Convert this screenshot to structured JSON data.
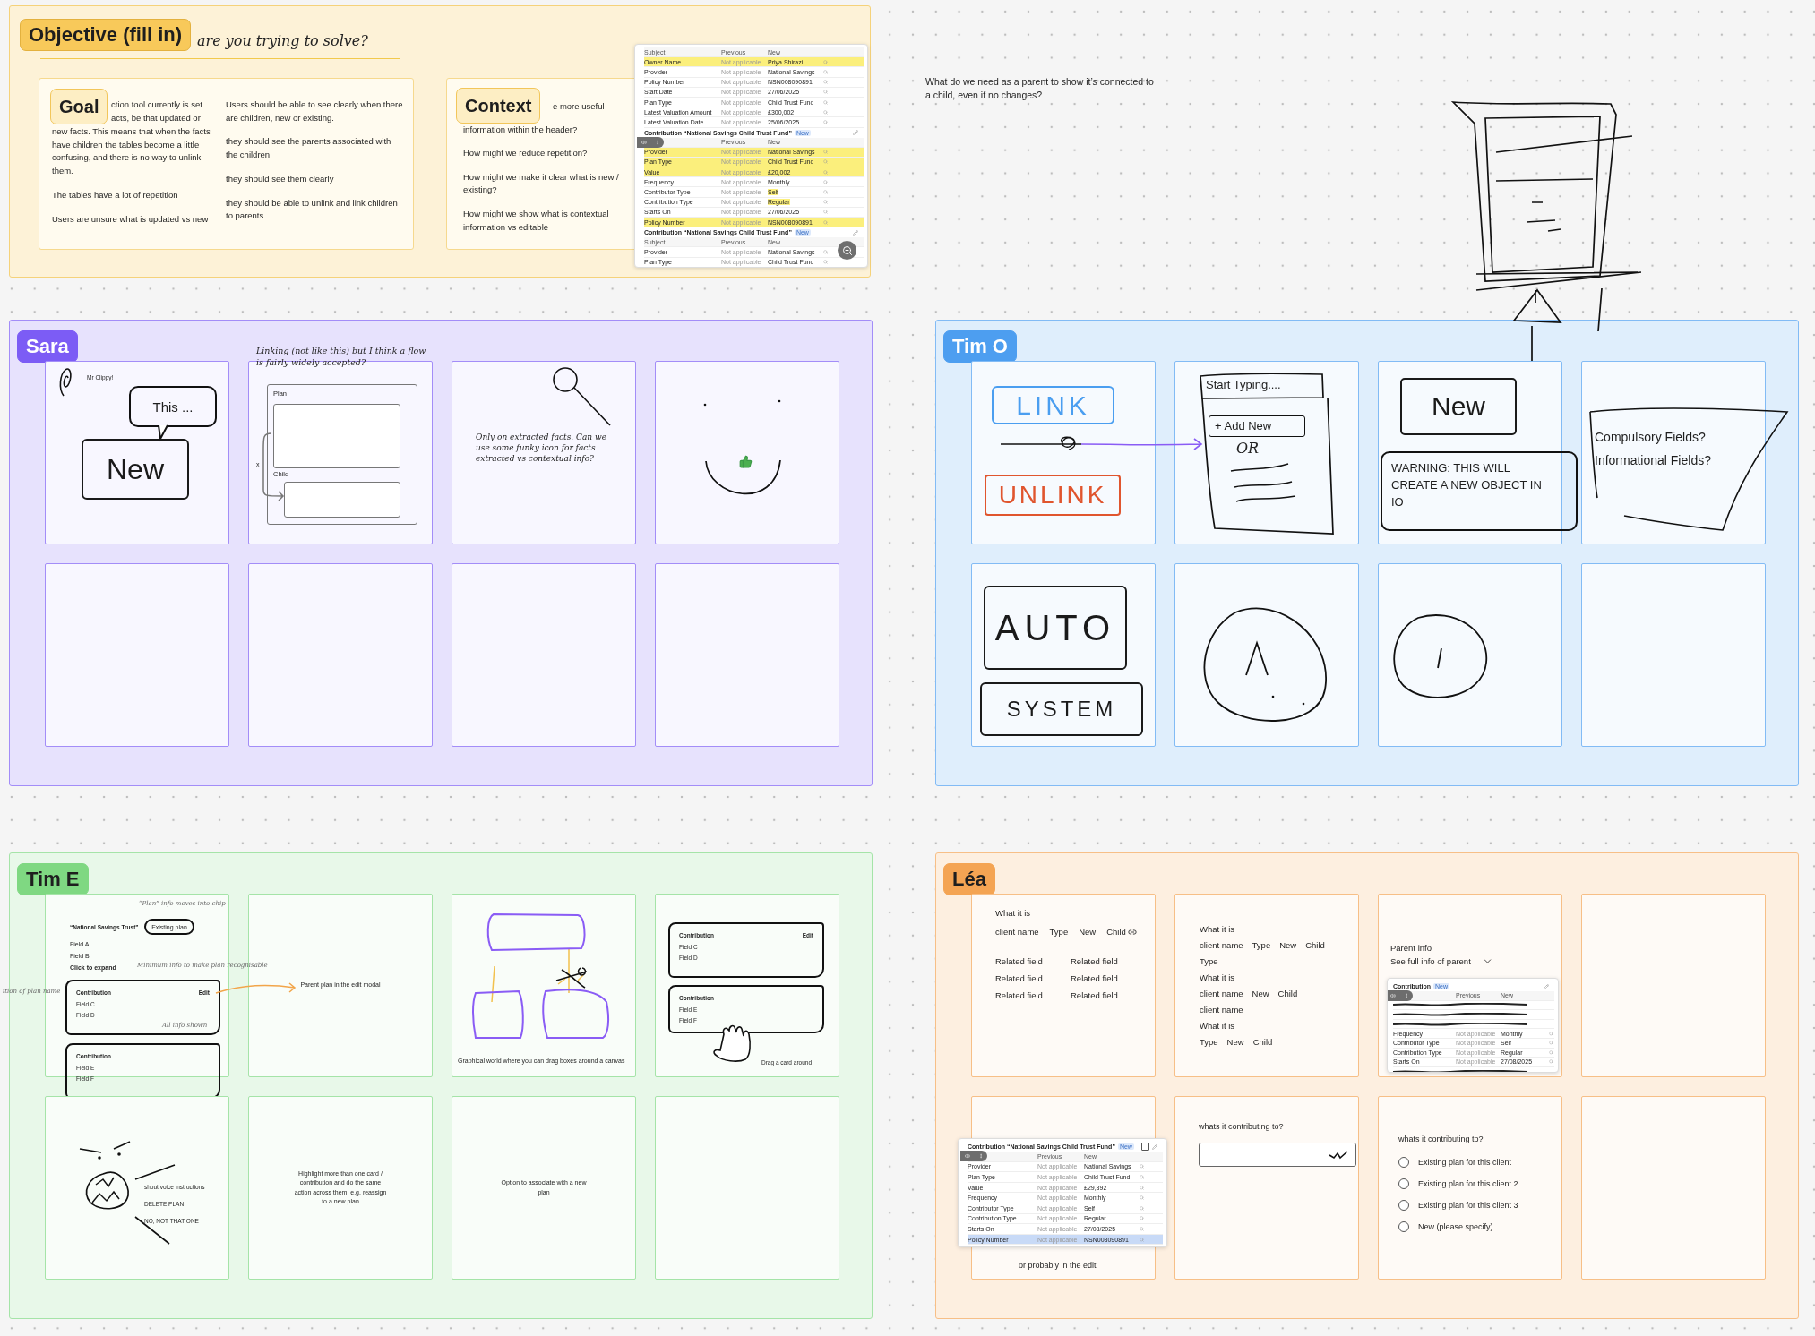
{
  "objective": {
    "title": "Objective (fill in)",
    "note": "are you trying to solve?",
    "goal": {
      "label": "Goal",
      "fragments": [
        "ction tool currently is set",
        "acts, be that updated or"
      ],
      "left": [
        "new facts. This means that when the facts have children the tables become a little confusing, and there is no way to unlink them.",
        "The tables have a lot of repetition",
        "Users are unsure what is updated vs new"
      ],
      "right": [
        "Users should be able to see clearly when there are children, new or existing.",
        "they should see the parents associated with the children",
        "they should see them clearly",
        "they should be able to unlink and link children to parents."
      ]
    },
    "context": {
      "label": "Context",
      "fragments": [
        "e more useful",
        "information within the header?"
      ],
      "questions": [
        "How might we reduce repetition?",
        "How might we make it clear what is new / existing?",
        "How might we show what is contextual information vs editable"
      ]
    },
    "screenshot": {
      "rows": [
        {
          "kind": "head",
          "cells": [
            "Subject",
            "Previous",
            "New"
          ],
          "covered": false
        },
        {
          "kind": "marked",
          "cells": [
            "Owner Name",
            "Not applicable",
            "Priya Shirazi"
          ],
          "color": "#fbef7c"
        },
        {
          "kind": "data",
          "cells": [
            "Provider",
            "Not applicable",
            "National Savings"
          ]
        },
        {
          "kind": "data",
          "cells": [
            "Policy Number",
            "Not applicable",
            "NSN008090891"
          ]
        },
        {
          "kind": "data",
          "cells": [
            "Start Date",
            "Not applicable",
            "27/06/2025"
          ]
        },
        {
          "kind": "data",
          "cells": [
            "Plan Type",
            "Not applicable",
            "Child Trust Fund"
          ]
        },
        {
          "kind": "data",
          "cells": [
            "Latest Valuation Amount",
            "Not applicable",
            "£300,002"
          ]
        },
        {
          "kind": "data",
          "cells": [
            "Latest Valuation Date",
            "Not applicable",
            "25/06/2025"
          ]
        },
        {
          "kind": "section",
          "title": "Contribution “National Savings Child Trust Fund”",
          "badge": "New"
        },
        {
          "kind": "head",
          "cells": [
            "Previous",
            "New"
          ],
          "covered": true
        },
        {
          "kind": "marked",
          "cells": [
            "Provider",
            "Not applicable",
            "National Savings"
          ],
          "color": "#fbef7c"
        },
        {
          "kind": "marked",
          "cells": [
            "Plan Type",
            "Not applicable",
            "Child Trust Fund"
          ],
          "color": "#fbef7c"
        },
        {
          "kind": "marked",
          "cells": [
            "Value",
            "Not applicable",
            "£20,002"
          ],
          "color": "#fbef7c"
        },
        {
          "kind": "data",
          "cells": [
            "Frequency",
            "Not applicable",
            "Monthly"
          ]
        },
        {
          "kind": "tagged",
          "cells": [
            "Contributor Type",
            "Not applicable",
            "Self"
          ],
          "color": "#fbef7c"
        },
        {
          "kind": "tagged",
          "cells": [
            "Contribution Type",
            "Not applicable",
            "Regular"
          ],
          "color": "#fbef7c"
        },
        {
          "kind": "data",
          "cells": [
            "Starts On",
            "Not applicable",
            "27/06/2025"
          ]
        },
        {
          "kind": "marked",
          "cells": [
            "Policy Number",
            "Not applicable",
            "NSN008090891"
          ],
          "color": "#fbef7c"
        },
        {
          "kind": "section",
          "title": "Contribution “National Savings Child Trust Fund”",
          "badge": "New"
        },
        {
          "kind": "head",
          "cells": [
            "Subject",
            "Previous",
            "New"
          ],
          "covered": false
        },
        {
          "kind": "data",
          "cells": [
            "Provider",
            "Not applicable",
            "National Savings"
          ]
        },
        {
          "kind": "data",
          "cells": [
            "Plan Type",
            "Not applicable",
            "Child Trust Fund"
          ]
        }
      ]
    }
  },
  "question": "What do we need as a parent to show it’s connected to a child, even if no changes?",
  "sections": [
    {
      "name": "Sara",
      "color": "#7c5cf5",
      "cards": [
        {
          "kind": "clippy",
          "caption": "Mr Clippy!",
          "bubble": "This ...",
          "word": "New"
        },
        {
          "kind": "flow",
          "note": "Linking (not like this) but I think a flow is fairly widely accepted?",
          "plan": "Plan",
          "child": "Child",
          "mark": "x"
        },
        {
          "kind": "magnifier",
          "text": "Only on extracted facts. Can we use some funky icon for facts extracted vs contextual info?"
        },
        {
          "kind": "smile"
        },
        {
          "kind": "empty"
        },
        {
          "kind": "empty"
        },
        {
          "kind": "empty"
        },
        {
          "kind": "empty"
        }
      ]
    },
    {
      "name": "Tim O",
      "color": "#4d9ef0",
      "cards": [
        {
          "kind": "link",
          "link": "LINK",
          "unlink": "UNLINK"
        },
        {
          "kind": "dropdown",
          "placeholder": "Start Typing....",
          "option": "+ Add New",
          "alt": "OR"
        },
        {
          "kind": "warning",
          "word": "New",
          "text": "WARNING: THIS WILL CREATE A NEW OBJECT IN IO"
        },
        {
          "kind": "fields",
          "lines": [
            "Compulsory Fields?",
            "Informational Fields?"
          ]
        },
        {
          "kind": "auto",
          "top": "AUTO",
          "bottom": "SYSTEM"
        },
        {
          "kind": "circle-caret"
        },
        {
          "kind": "circle-line"
        },
        {
          "kind": "empty"
        }
      ]
    },
    {
      "name": "Tim E",
      "color": "#7fd882",
      "cards": [
        {
          "kind": "plan-chip",
          "note": "“Plan” info moves into chip",
          "plan": "“National Savings Trust”",
          "chip": "Existing plan",
          "fields": [
            "Field A",
            "Field B"
          ],
          "expand": "Click to expand",
          "hint": "Minimum info to make plan recognisable",
          "side": "ition of plan name",
          "contributions": [
            {
              "title": "Contribution",
              "action": "Edit",
              "fields": [
                "Field C",
                "Field D"
              ],
              "note": "All info shown"
            },
            {
              "title": "Contribution",
              "fields": [
                "Field E",
                "Field F"
              ]
            }
          ]
        },
        {
          "kind": "text",
          "text": "Parent plan in the edit modal"
        },
        {
          "kind": "canvas",
          "caption": "Graphical world where you can drag boxes around a canvas"
        },
        {
          "kind": "drag",
          "caption": "Drag a card around",
          "contributions": [
            {
              "title": "Contribution",
              "action": "Edit",
              "fields": [
                "Field C",
                "Field D"
              ]
            },
            {
              "title": "Contribution",
              "fields": [
                "Field E",
                "Field F"
              ]
            }
          ]
        },
        {
          "kind": "shout",
          "lines": [
            "shout voice instructions",
            "DELETE PLAN",
            "NO, NOT THAT ONE"
          ]
        },
        {
          "kind": "text",
          "text": "Highlight more than one card / contribution and do the same action across them, e.g. reassign to a new plan"
        },
        {
          "kind": "text",
          "text": "Option to associate with a new plan"
        },
        {
          "kind": "empty"
        }
      ]
    },
    {
      "name": "Léa",
      "color": "#f4a453",
      "cards": [
        {
          "kind": "fields-a",
          "title": "What it is",
          "row": [
            "client name",
            "Type",
            "New",
            "Child"
          ],
          "related": [
            "Related field",
            "Related field",
            "Related field",
            "Related field",
            "Related field",
            "Related field"
          ]
        },
        {
          "kind": "fields-b",
          "lines": [
            [
              "What it is"
            ],
            [
              "client name",
              "Type",
              "New",
              "Child"
            ],
            [
              "Type"
            ],
            [
              "What it is"
            ],
            [
              "client name",
              "New",
              "Child"
            ],
            [
              "client name"
            ],
            [
              "What it is"
            ],
            [
              "Type",
              "New",
              "Child"
            ]
          ]
        },
        {
          "kind": "parent",
          "title": "Parent info",
          "link": "See full info of parent",
          "screenshot": {
            "rows": [
              {
                "kind": "section",
                "title": "Contribution",
                "badge": "New"
              },
              {
                "kind": "head",
                "cells": [
                  "Previous",
                  "New"
                ],
                "covered": true
              },
              {
                "kind": "struck"
              },
              {
                "kind": "struck"
              },
              {
                "kind": "struck"
              },
              {
                "kind": "data",
                "cells": [
                  "Frequency",
                  "Not applicable",
                  "Monthly"
                ]
              },
              {
                "kind": "data",
                "cells": [
                  "Contributor Type",
                  "Not applicable",
                  "Self"
                ]
              },
              {
                "kind": "data",
                "cells": [
                  "Contribution Type",
                  "Not applicable",
                  "Regular"
                ]
              },
              {
                "kind": "data",
                "cells": [
                  "Starts On",
                  "Not applicable",
                  "27/08/2025"
                ]
              },
              {
                "kind": "struck"
              }
            ]
          }
        },
        {
          "kind": "empty"
        },
        {
          "kind": "edit-shot",
          "caption": "or probably in the edit",
          "screenshot": {
            "rows": [
              {
                "kind": "section",
                "title": "Contribution “National Savings Child Trust Fund”",
                "badge": "New",
                "checked": false
              },
              {
                "kind": "head",
                "cells": [
                  "Previous",
                  "New"
                ],
                "covered": true
              },
              {
                "kind": "data",
                "cells": [
                  "Provider",
                  "Not applicable",
                  "National Savings"
                ]
              },
              {
                "kind": "data",
                "cells": [
                  "Plan Type",
                  "Not applicable",
                  "Child Trust Fund"
                ]
              },
              {
                "kind": "data",
                "cells": [
                  "Value",
                  "Not applicable",
                  "£29,392"
                ]
              },
              {
                "kind": "data",
                "cells": [
                  "Frequency",
                  "Not applicable",
                  "Monthly"
                ]
              },
              {
                "kind": "data",
                "cells": [
                  "Contributor Type",
                  "Not applicable",
                  "Self"
                ]
              },
              {
                "kind": "data",
                "cells": [
                  "Contribution Type",
                  "Not applicable",
                  "Regular"
                ]
              },
              {
                "kind": "data",
                "cells": [
                  "Starts On",
                  "Not applicable",
                  "27/08/2025"
                ]
              },
              {
                "kind": "marked",
                "cells": [
                  "Policy Number",
                  "Not applicable",
                  "NSN008090891"
                ],
                "color": "#c8daf7"
              }
            ]
          }
        },
        {
          "kind": "select",
          "question": "whats it contributing to?"
        },
        {
          "kind": "radios",
          "question": "whats it contributing to?",
          "options": [
            {
              "label": "Existing plan for this client",
              "selected": false
            },
            {
              "label": "Existing plan for this client 2",
              "selected": false
            },
            {
              "label": "Existing plan for this client 3",
              "selected": false
            },
            {
              "label": "New (please specify)",
              "selected": false
            }
          ]
        },
        {
          "kind": "empty"
        }
      ]
    }
  ]
}
